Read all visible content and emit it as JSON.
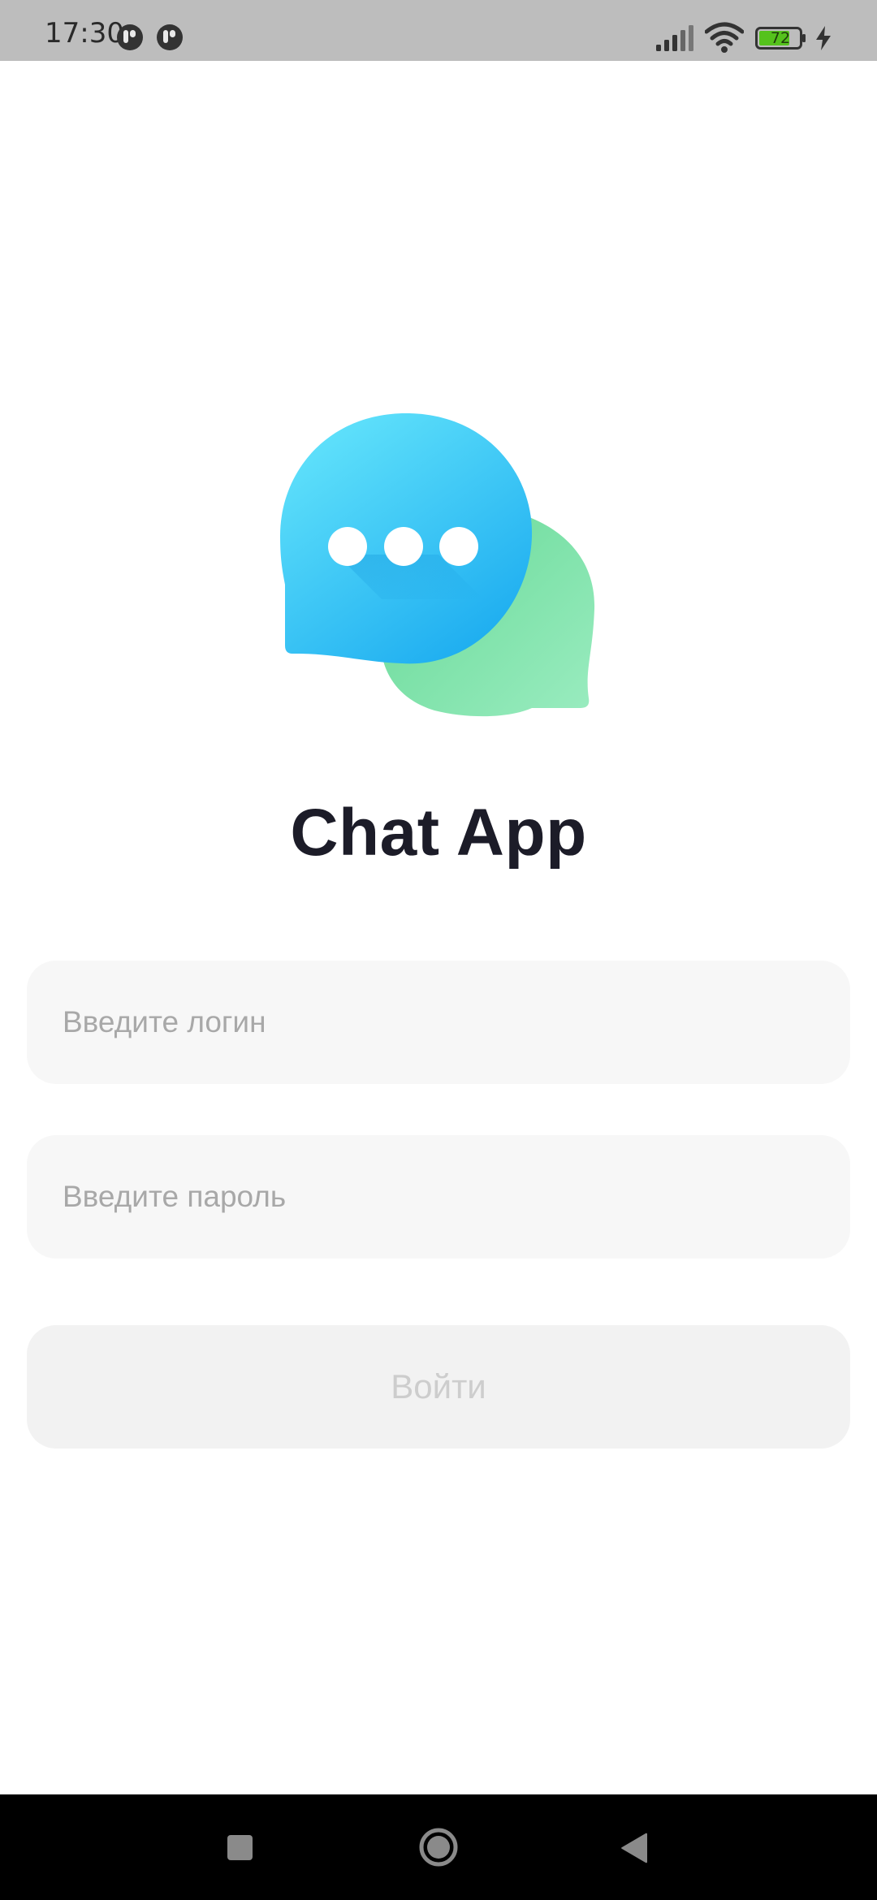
{
  "status_bar": {
    "time": "17:30",
    "battery_level": "72",
    "icons": [
      "notification-icon",
      "notification-icon",
      "signal-icon",
      "wifi-icon",
      "battery-icon",
      "charging-icon"
    ]
  },
  "app": {
    "title": "Chat App",
    "logo_icon": "chat-bubbles-icon"
  },
  "form": {
    "login_placeholder": "Введите логин",
    "password_placeholder": "Введите пароль",
    "submit_label": "Войти"
  },
  "nav_bar": {
    "icons": [
      "recents-icon",
      "home-icon",
      "back-icon"
    ]
  },
  "colors": {
    "status_bar": "#bdbdbd",
    "bubble_blue": "#3ec5f5",
    "bubble_green": "#7ddfa9",
    "title": "#1c1c28",
    "field_bg": "#f7f7f7",
    "button_bg": "#f2f2f2",
    "button_text_disabled": "#cdcdcd"
  }
}
